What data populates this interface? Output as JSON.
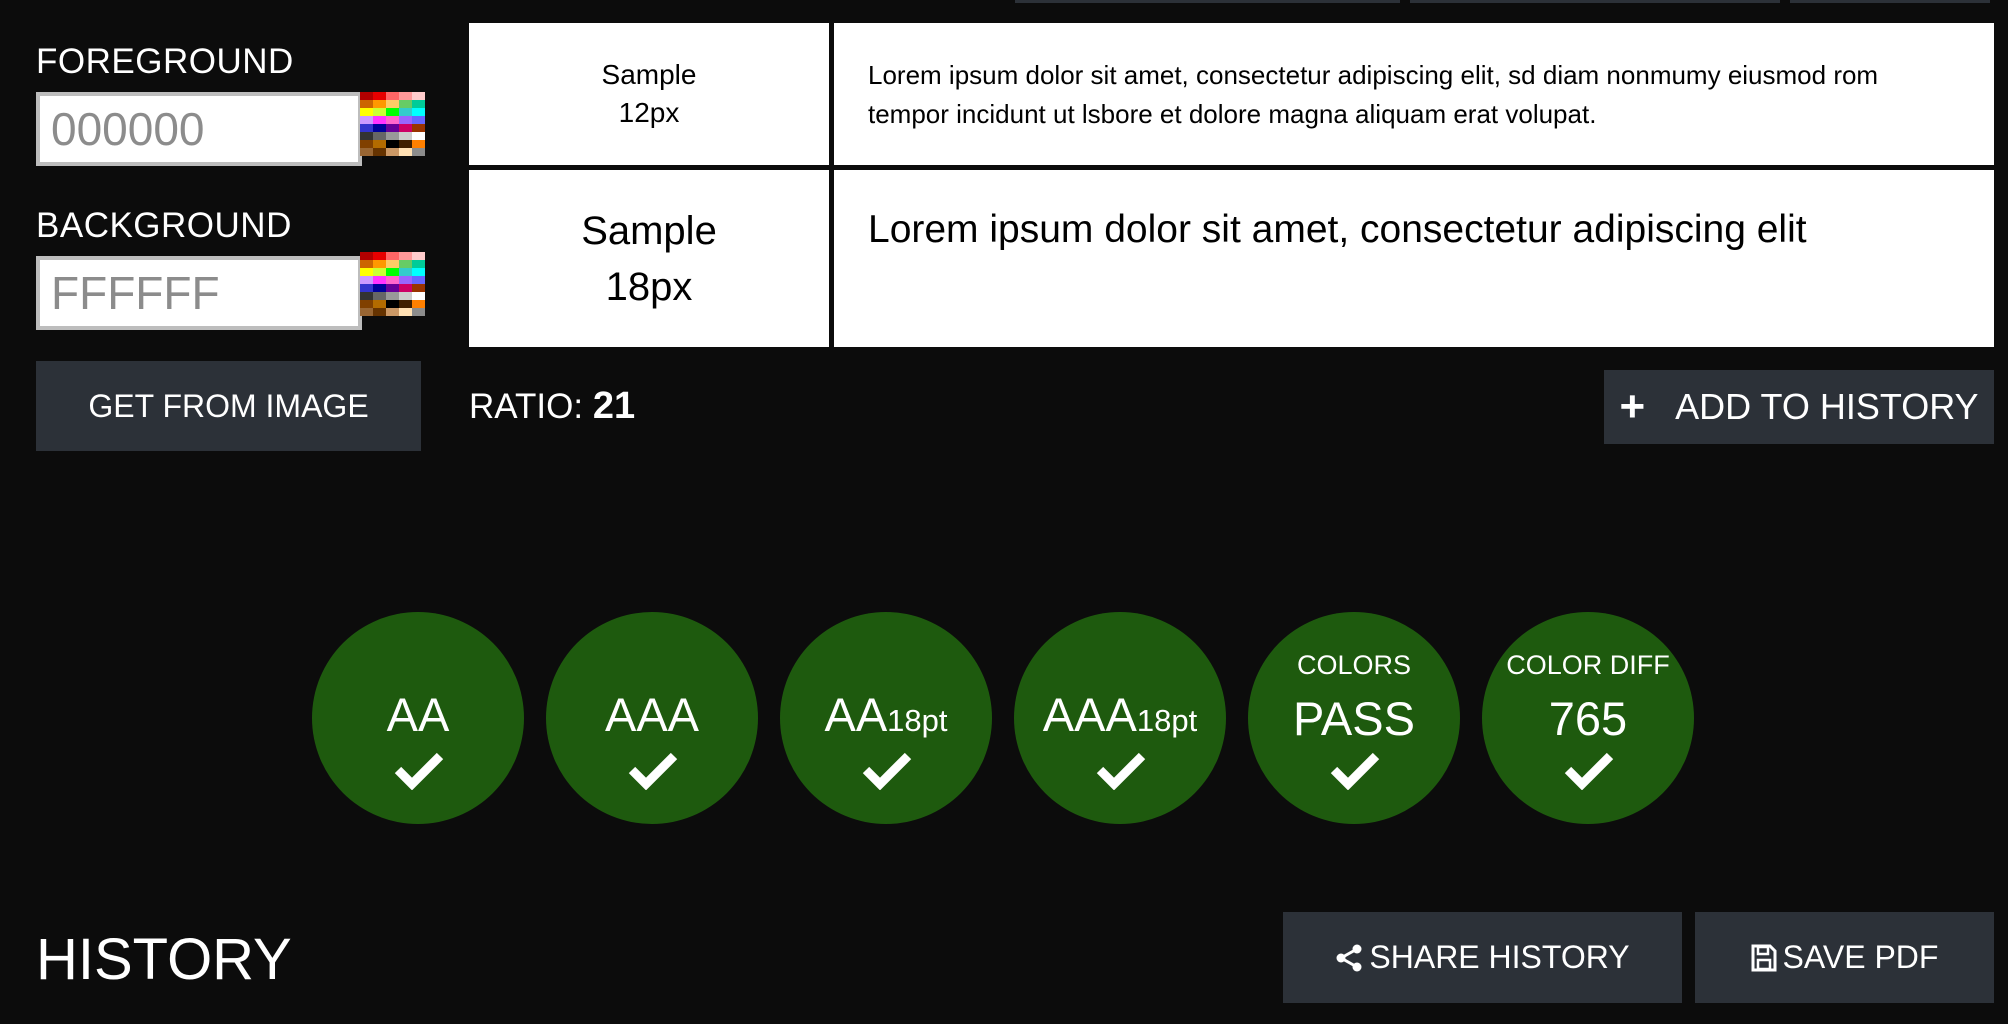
{
  "foreground": {
    "label": "FOREGROUND",
    "value": "000000"
  },
  "background": {
    "label": "BACKGROUND",
    "value": "FFFFFF"
  },
  "get_from_image_label": "GET FROM IMAGE",
  "samples": [
    {
      "size_label": "Sample",
      "size_value": "12px",
      "text": "Lorem ipsum dolor sit amet, consectetur adipiscing elit, sd diam nonmumy eiusmod rom tempor incidunt ut lsbore et dolore magna aliquam erat volupat."
    },
    {
      "size_label": "Sample",
      "size_value": "18px",
      "text": "Lorem ipsum dolor sit amet, consectetur adipiscing elit"
    }
  ],
  "ratio": {
    "label": "RATIO:",
    "value": "21"
  },
  "add_history_label": "ADD TO HISTORY",
  "badges": [
    {
      "main": "AA",
      "suffix": "",
      "status": "pass"
    },
    {
      "main": "AAA",
      "suffix": "",
      "status": "pass"
    },
    {
      "main": "AA",
      "suffix": "18pt",
      "status": "pass"
    },
    {
      "main": "AAA",
      "suffix": "18pt",
      "status": "pass"
    },
    {
      "top": "COLORS",
      "main": "PASS",
      "status": "pass"
    },
    {
      "top": "COLOR DIFF",
      "main": "765",
      "status": "pass"
    }
  ],
  "history": {
    "title": "HISTORY",
    "share_label": "SHARE HISTORY",
    "save_label": "SAVE PDF"
  },
  "colors": {
    "page_bg": "#0c0c0c",
    "button_bg": "#2c3138",
    "badge_green": "#1e5a0e"
  },
  "palette": [
    "#b30000",
    "#e60000",
    "#ff6666",
    "#ff9999",
    "#ffcccc",
    "#cc6600",
    "#ff9900",
    "#ffcc66",
    "#66cc66",
    "#00cc99",
    "#ffff00",
    "#ccff33",
    "#00ff00",
    "#33cccc",
    "#00ffff",
    "#cc99ff",
    "#ff33ff",
    "#ff66cc",
    "#9966ff",
    "#6666ff",
    "#3333cc",
    "#000099",
    "#660099",
    "#cc0066",
    "#993300",
    "#333333",
    "#666666",
    "#999999",
    "#cccccc",
    "#ffffff",
    "#804000",
    "#b36b00",
    "#000000",
    "#402000",
    "#ff8000",
    "#996633",
    "#663300",
    "#cc9966",
    "#ffe0b3",
    "#8c8c8c"
  ]
}
